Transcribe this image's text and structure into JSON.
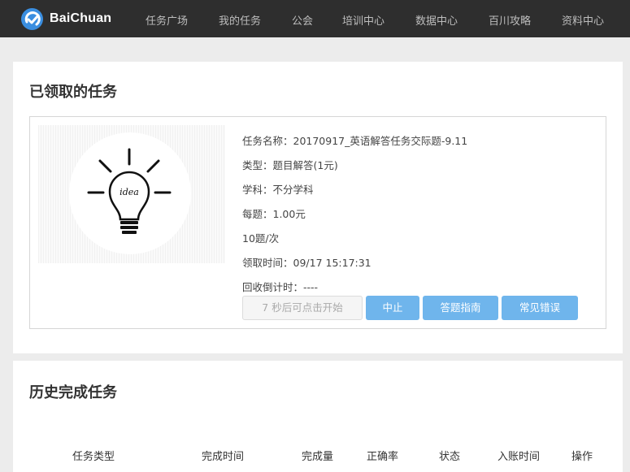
{
  "brand": {
    "name": "BaiChuan"
  },
  "nav": {
    "items": [
      {
        "label": "任务广场"
      },
      {
        "label": "我的任务"
      },
      {
        "label": "公会"
      },
      {
        "label": "培训中心"
      },
      {
        "label": "数据中心"
      },
      {
        "label": "百川攻略"
      },
      {
        "label": "资料中心"
      }
    ]
  },
  "claimed": {
    "title": "已领取的任务",
    "task": {
      "thumbnail_icon": "lightbulb-idea-icon",
      "thumbnail_text": "idea",
      "name_line": "任务名称：20170917_英语解答任务交际题-9.11",
      "type_line": "类型：题目解答(1元)",
      "subject_line": "学科：不分学科",
      "price_line": "每题：1.00元",
      "count_line": "10题/次",
      "claimed_time_line": "领取时间：09/17 15:17:31",
      "countdown_line": "回收倒计时：----"
    },
    "buttons": {
      "start_label": "7 秒后可点击开始",
      "stop_label": "中止",
      "guide_label": "答题指南",
      "errors_label": "常见错误"
    }
  },
  "history": {
    "title": "历史完成任务",
    "columns": [
      "任务类型",
      "完成时间",
      "完成量",
      "正确率",
      "状态",
      "入账时间",
      "操作"
    ]
  },
  "colors": {
    "topbar": "#2e2e2e",
    "brand_blue": "#3a8ee0",
    "button_blue": "#6fb5ec",
    "page_bg": "#ececec"
  }
}
